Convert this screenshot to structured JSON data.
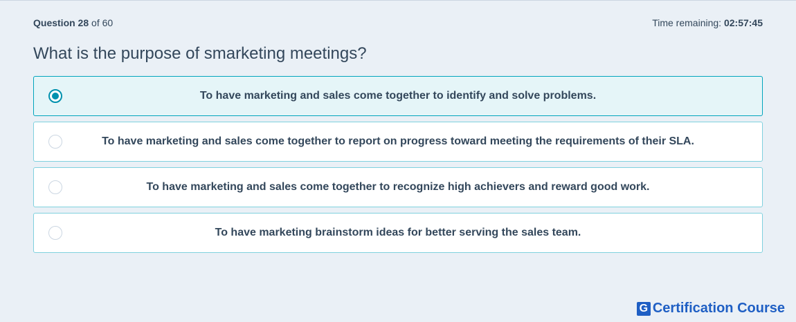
{
  "header": {
    "question_label": "Question 28",
    "question_of": "of 60",
    "time_label": "Time remaining:",
    "time_value": "02:57:45"
  },
  "question": {
    "text": "What is the purpose of smarketing meetings?"
  },
  "options": [
    {
      "text": "To have marketing and sales come together to identify and solve problems.",
      "selected": true
    },
    {
      "text": "To have marketing and sales come together to report on progress toward meeting the requirements of their SLA.",
      "selected": false
    },
    {
      "text": "To have marketing and sales come together to recognize high achievers and reward good work.",
      "selected": false
    },
    {
      "text": "To have marketing brainstorm ideas for better serving the sales team.",
      "selected": false
    }
  ],
  "brand": {
    "mark": "G",
    "name": "Certification Course"
  },
  "colors": {
    "background": "#eaf0f6",
    "text": "#33475b",
    "option_border": "#7fd1de",
    "selected_bg": "#e5f5f8",
    "radio_accent": "#0091ae",
    "brand": "#1f5fc4"
  }
}
